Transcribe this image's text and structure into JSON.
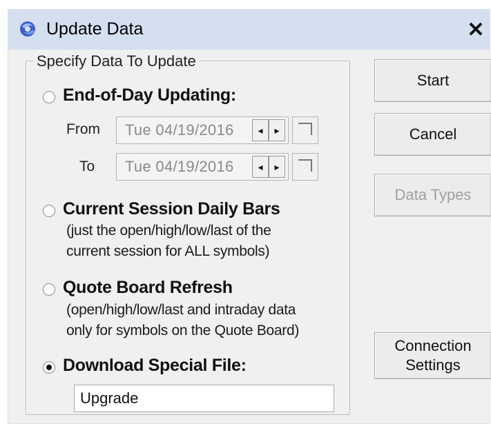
{
  "window": {
    "title": "Update Data",
    "close_label": "✕"
  },
  "group": {
    "label": "Specify Data To Update"
  },
  "options": {
    "eod": {
      "label": "End-of-Day Updating:",
      "selected": false
    },
    "current_session": {
      "label": "Current Session Daily Bars",
      "desc_line1": "(just the open/high/low/last of the",
      "desc_line2": "current session for ALL symbols)",
      "selected": false
    },
    "quote_board": {
      "label": "Quote Board Refresh",
      "desc_line1": "(open/high/low/last and intraday data",
      "desc_line2": "only for symbols on the Quote Board)",
      "selected": false
    },
    "special_file": {
      "label": "Download Special File:",
      "selected": true
    }
  },
  "dates": {
    "from_label": "From",
    "from_value": "Tue  04/19/2016",
    "to_label": "To",
    "to_value": "Tue  04/19/2016",
    "spin_left": "◂",
    "spin_right": "▸"
  },
  "special_file_input": {
    "value": "Upgrade"
  },
  "buttons": {
    "start": "Start",
    "cancel": "Cancel",
    "data_types": "Data Types",
    "connection_line1": "Connection",
    "connection_line2": "Settings"
  }
}
